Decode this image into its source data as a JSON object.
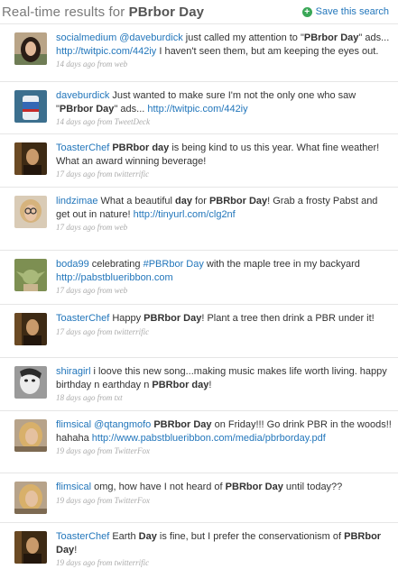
{
  "header": {
    "title_prefix": "Real-time results for",
    "query": "PBrbor Day",
    "save_label": "Save this search"
  },
  "tweets": [
    {
      "user": "socialmedium",
      "parts": [
        {
          "t": "mention",
          "v": "@daveburdick"
        },
        {
          "t": "text",
          "v": " just called my attention to \""
        },
        {
          "t": "bold",
          "v": "PBrbor Day"
        },
        {
          "t": "text",
          "v": "\" ads... "
        },
        {
          "t": "url",
          "v": "http://twitpic.com/442iy"
        },
        {
          "t": "text",
          "v": " I haven't seen them, but am keeping the eyes out."
        }
      ],
      "time": "14 days ago",
      "source": "web",
      "avatar": "woman-dark-hair-icon"
    },
    {
      "user": "daveburdick",
      "parts": [
        {
          "t": "text",
          "v": "Just wanted to make sure I'm not the only one who saw \""
        },
        {
          "t": "bold",
          "v": "PBrbor Day"
        },
        {
          "t": "text",
          "v": "\" ads... "
        },
        {
          "t": "url",
          "v": "http://twitpic.com/442iy"
        }
      ],
      "time": "14 days ago",
      "source": "TweetDeck",
      "avatar": "beer-can-icon"
    },
    {
      "user": "ToasterChef",
      "parts": [
        {
          "t": "bold",
          "v": "PBRbor day"
        },
        {
          "t": "text",
          "v": " is being kind to us this year. What fine weather! What an award winning beverage!"
        }
      ],
      "time": "17 days ago",
      "source": "twitterrific",
      "avatar": "man-dark-icon"
    },
    {
      "user": "lindzimae",
      "parts": [
        {
          "t": "text",
          "v": "What a beautiful "
        },
        {
          "t": "bold",
          "v": "day"
        },
        {
          "t": "text",
          "v": " for "
        },
        {
          "t": "bold",
          "v": "PBRbor Day"
        },
        {
          "t": "text",
          "v": "! Grab a frosty Pabst and get out in nature! "
        },
        {
          "t": "url",
          "v": "http://tinyurl.com/clg2nf"
        }
      ],
      "time": "17 days ago",
      "source": "web",
      "avatar": "woman-glasses-icon"
    },
    {
      "user": "boda99",
      "parts": [
        {
          "t": "text",
          "v": "celebrating "
        },
        {
          "t": "hashtag",
          "v": "#PBRbor Day"
        },
        {
          "t": "text",
          "v": " with the maple tree in my backyard "
        },
        {
          "t": "url",
          "v": "http://pabstblueribbon.com"
        }
      ],
      "time": "17 days ago",
      "source": "web",
      "avatar": "yoda-icon"
    },
    {
      "user": "ToasterChef",
      "parts": [
        {
          "t": "text",
          "v": "Happy "
        },
        {
          "t": "bold",
          "v": "PBRbor Day"
        },
        {
          "t": "text",
          "v": "! Plant a tree then drink a PBR under it!"
        }
      ],
      "time": "17 days ago",
      "source": "twitterrific",
      "avatar": "man-dark-icon"
    },
    {
      "user": "shiragirl",
      "parts": [
        {
          "t": "text",
          "v": "i loove this new song...making music makes life worth living. happy birthday n earthday n "
        },
        {
          "t": "bold",
          "v": "PBRbor day"
        },
        {
          "t": "text",
          "v": "!"
        }
      ],
      "time": "18 days ago",
      "source": "txt",
      "avatar": "bw-face-icon"
    },
    {
      "user": "flimsical",
      "parts": [
        {
          "t": "mention",
          "v": "@qtangmofo"
        },
        {
          "t": "text",
          "v": " "
        },
        {
          "t": "bold",
          "v": "PBRbor Day"
        },
        {
          "t": "text",
          "v": " on Friday!!! Go drink PBR in the woods!! hahaha "
        },
        {
          "t": "url",
          "v": "http://www.pabstblueribbon.com/media/pbrborday.pdf"
        }
      ],
      "time": "19 days ago",
      "source": "TwitterFox",
      "avatar": "woman-blonde-icon"
    },
    {
      "user": "flimsical",
      "parts": [
        {
          "t": "text",
          "v": "omg, how have I not heard of "
        },
        {
          "t": "bold",
          "v": "PBRbor Day"
        },
        {
          "t": "text",
          "v": " until today??"
        }
      ],
      "time": "19 days ago",
      "source": "TwitterFox",
      "avatar": "woman-blonde-icon"
    },
    {
      "user": "ToasterChef",
      "parts": [
        {
          "t": "text",
          "v": "Earth "
        },
        {
          "t": "bold",
          "v": "Day"
        },
        {
          "t": "text",
          "v": " is fine, but I prefer the conservationism of "
        },
        {
          "t": "bold",
          "v": "PBRbor Day"
        },
        {
          "t": "text",
          "v": "!"
        }
      ],
      "time": "19 days ago",
      "source": "twitterrific",
      "avatar": "man-dark-icon"
    }
  ]
}
